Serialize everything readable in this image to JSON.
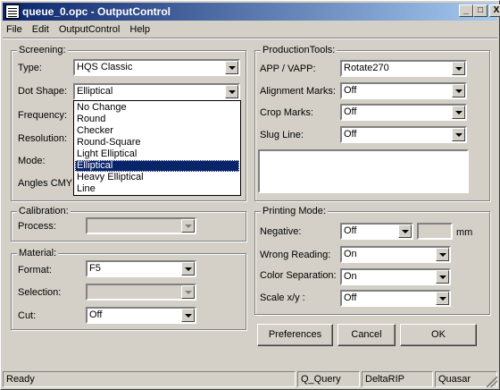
{
  "window": {
    "title": "queue_0.opc - OutputControl"
  },
  "title_buttons": {
    "minimize": "_",
    "maximize": "□",
    "close": "X"
  },
  "menu": [
    "File",
    "Edit",
    "OutputControl",
    "Help"
  ],
  "screening": {
    "legend": "Screening:",
    "type_label": "Type:",
    "type_value": "HQS Classic",
    "dot_shape_label": "Dot Shape:",
    "dot_shape_value": "Elliptical",
    "frequency_label": "Frequency:",
    "resolution_label": "Resolution:",
    "mode_label": "Mode:",
    "angles_label": "Angles CMYK:",
    "dot_shape_options": [
      "No Change",
      "Round",
      "Checker",
      "Round-Square",
      "Light Elliptical",
      "Elliptical",
      "Heavy Elliptical",
      "Line"
    ],
    "selected_option": "Elliptical"
  },
  "calibration": {
    "legend": "Calibration:",
    "process_label": "Process:",
    "process_value": ""
  },
  "material": {
    "legend": "Material:",
    "format_label": "Format:",
    "format_value": "F5",
    "selection_label": "Selection:",
    "selection_value": "",
    "cut_label": "Cut:",
    "cut_value": "Off"
  },
  "production_tools": {
    "legend": "ProductionTools:",
    "app_label": "APP / VAPP:",
    "app_value": "Rotate270",
    "alignment_label": "Alignment Marks:",
    "alignment_value": "Off",
    "crop_label": "Crop Marks:",
    "crop_value": "Off",
    "slug_label": "Slug Line:",
    "slug_value": "Off"
  },
  "printing_mode": {
    "legend": "Printing Mode:",
    "negative_label": "Negative:",
    "negative_value": "Off",
    "negative_unit": "mm",
    "wrong_reading_label": "Wrong Reading:",
    "wrong_reading_value": "On",
    "color_sep_label": "Color Separation:",
    "color_sep_value": "On",
    "scale_label": "Scale x/y :",
    "scale_value": "Off"
  },
  "buttons": {
    "preferences": "Preferences",
    "cancel": "Cancel",
    "ok": "OK"
  },
  "status_bar": {
    "left": "Ready",
    "query": "Q_Query",
    "rip": "DeltaRIP",
    "server": "Quasar"
  }
}
